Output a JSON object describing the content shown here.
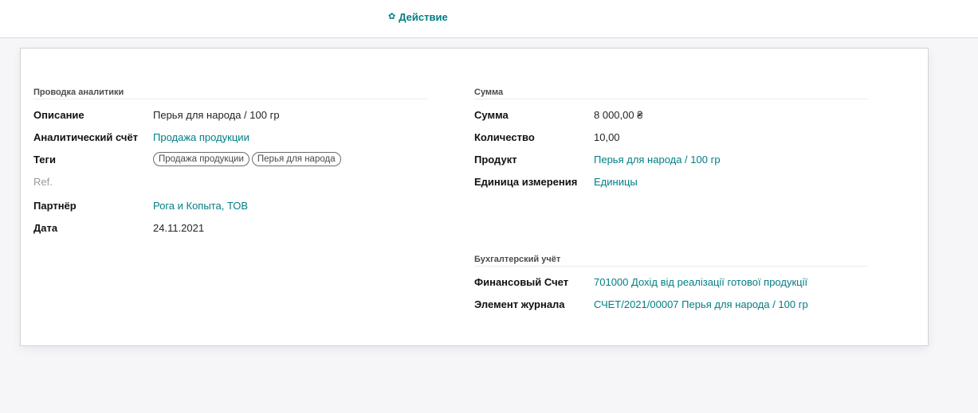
{
  "control_panel": {
    "action_label": "Действие"
  },
  "left_group": {
    "title": "Проводка аналитики",
    "fields": {
      "description": {
        "label": "Описание",
        "value": "Перья для народа / 100 гр"
      },
      "account": {
        "label": "Аналитический счёт",
        "value": "Продажа продукции"
      },
      "tags": {
        "label": "Теги",
        "values": [
          "Продажа продукции",
          "Перья для народа"
        ]
      },
      "ref": {
        "label": "Ref.",
        "value": ""
      },
      "partner": {
        "label": "Партнёр",
        "value": "Рога и Копыта, ТОВ"
      },
      "date": {
        "label": "Дата",
        "value": "24.11.2021"
      }
    }
  },
  "amount_group": {
    "title": "Сумма",
    "fields": {
      "amount": {
        "label": "Сумма",
        "value": "8 000,00 ₴"
      },
      "quantity": {
        "label": "Количество",
        "value": "10,00"
      },
      "product": {
        "label": "Продукт",
        "value": "Перья для народа / 100 гр"
      },
      "uom": {
        "label": "Единица измерения",
        "value": "Единицы"
      }
    }
  },
  "accounting_group": {
    "title": "Бухгалтерский учёт",
    "fields": {
      "financial_account": {
        "label": "Финансовый Счет",
        "value": "701000 Дохід від реалізації готової продукції"
      },
      "journal_item": {
        "label": "Элемент журнала",
        "value": "СЧЕТ/2021/00007 Перья для народа / 100 гр"
      }
    }
  }
}
